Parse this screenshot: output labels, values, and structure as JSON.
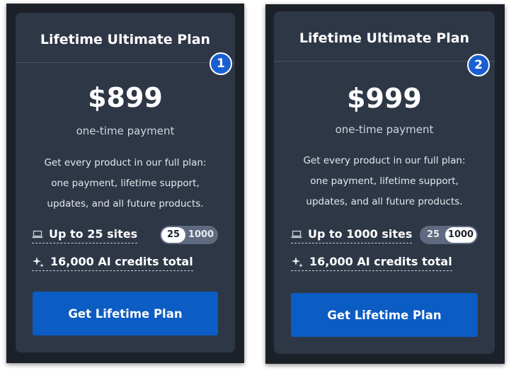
{
  "colors": {
    "card_bg": "#2e3746",
    "frame_bg": "#1c2129",
    "accent": "#0b5cc3",
    "badge": "#1a5fd1"
  },
  "cards": [
    {
      "title": "Lifetime Ultimate Plan",
      "badge": "1",
      "price": "$899",
      "price_note": "one-time payment",
      "description_lines": [
        "Get every product in our full plan:",
        "one payment, lifetime support,",
        "updates, and all future products."
      ],
      "sites_feature": {
        "icon": "laptop-icon",
        "label": "Up to 25 sites"
      },
      "toggle": {
        "options": [
          "25",
          "1000"
        ],
        "selected": "25"
      },
      "credits_feature": {
        "icon": "sparkle-icon",
        "label": "16,000 AI credits total"
      },
      "cta_label": "Get Lifetime Plan"
    },
    {
      "title": "Lifetime Ultimate Plan",
      "badge": "2",
      "price": "$999",
      "price_note": "one-time payment",
      "description_lines": [
        "Get every product in our full plan:",
        "one payment, lifetime support,",
        "updates, and all future products."
      ],
      "sites_feature": {
        "icon": "laptop-icon",
        "label": "Up to 1000 sites"
      },
      "toggle": {
        "options": [
          "25",
          "1000"
        ],
        "selected": "1000"
      },
      "credits_feature": {
        "icon": "sparkle-icon",
        "label": "16,000 AI credits total"
      },
      "cta_label": "Get Lifetime Plan"
    }
  ]
}
